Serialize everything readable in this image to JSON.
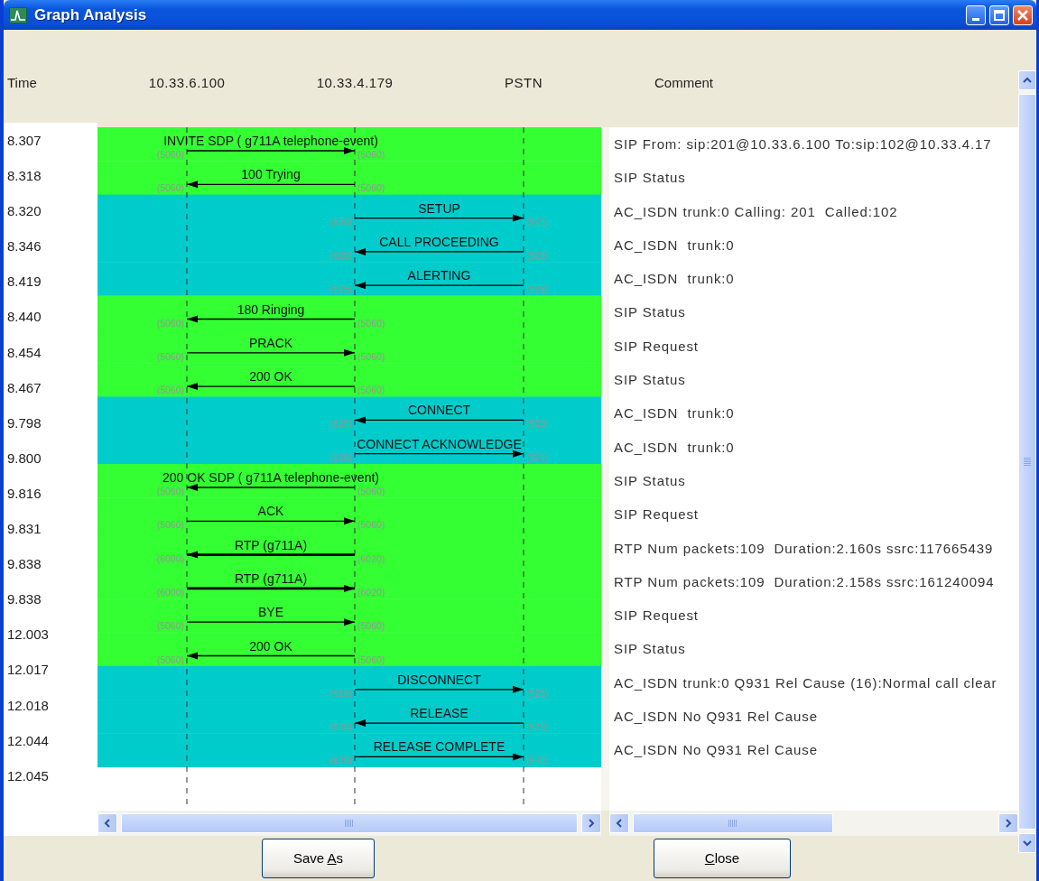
{
  "window": {
    "title": "Graph Analysis"
  },
  "header": {
    "time": "Time",
    "nodes": [
      "10.33.6.100",
      "10.33.4.179",
      "PSTN"
    ],
    "comment": "Comment"
  },
  "messages": [
    {
      "time": "8.307",
      "kind": "sip",
      "to_right": true,
      "label": "INVITE SDP ( g711A telephone-event)",
      "port_left": "(5060)",
      "port_right": "(5060)",
      "comment": "SIP From: sip:201@10.33.6.100 To:sip:102@10.33.4.17",
      "color": "#33ff33"
    },
    {
      "time": "8.318",
      "kind": "sip",
      "to_right": false,
      "label": "100 Trying",
      "port_left": "(5060)",
      "port_right": "(5060)",
      "comment": "SIP Status",
      "color": "#33ff33"
    },
    {
      "time": "8.320",
      "kind": "isdn",
      "to_right": true,
      "label": "SETUP",
      "port_left": "(928)",
      "port_right": "(925)",
      "comment": "AC_ISDN trunk:0 Calling: 201  Called:102",
      "color": "#00cccc"
    },
    {
      "time": "8.346",
      "kind": "isdn",
      "to_right": false,
      "label": "CALL PROCEEDING",
      "port_left": "(928)",
      "port_right": "(928)",
      "comment": "AC_ISDN  trunk:0",
      "color": "#00cccc"
    },
    {
      "time": "8.419",
      "kind": "isdn",
      "to_right": false,
      "label": "ALERTING",
      "port_left": "(925)",
      "port_right": "(928)",
      "comment": "AC_ISDN  trunk:0",
      "color": "#00cccc"
    },
    {
      "time": "8.440",
      "kind": "sip",
      "to_right": false,
      "label": "180 Ringing",
      "port_left": "(5060)",
      "port_right": "(5060)",
      "comment": "SIP Status",
      "color": "#33ff33"
    },
    {
      "time": "8.454",
      "kind": "sip",
      "to_right": true,
      "label": "PRACK",
      "port_left": "(5060)",
      "port_right": "(5060)",
      "comment": "SIP Request",
      "color": "#33ff33"
    },
    {
      "time": "8.467",
      "kind": "sip",
      "to_right": false,
      "label": "200 OK",
      "port_left": "(5060)",
      "port_right": "(5060)",
      "comment": "SIP Status",
      "color": "#33ff33"
    },
    {
      "time": "9.798",
      "kind": "isdn",
      "to_right": false,
      "label": "CONNECT",
      "port_left": "(925)",
      "port_right": "(928)",
      "comment": "AC_ISDN  trunk:0",
      "color": "#00cccc"
    },
    {
      "time": "9.800",
      "kind": "isdn",
      "to_right": true,
      "label": "CONNECT ACKNOWLEDGE",
      "port_left": "(928)",
      "port_right": "(925)",
      "comment": "AC_ISDN  trunk:0",
      "color": "#00cccc"
    },
    {
      "time": "9.816",
      "kind": "sip",
      "to_right": false,
      "label": "200 OK SDP ( g711A telephone-event)",
      "port_left": "(5060)",
      "port_right": "(5060)",
      "comment": "SIP Status",
      "color": "#33ff33"
    },
    {
      "time": "9.831",
      "kind": "sip",
      "to_right": true,
      "label": "ACK",
      "port_left": "(5060)",
      "port_right": "(5060)",
      "comment": "SIP Request",
      "color": "#33ff33"
    },
    {
      "time": "9.838",
      "kind": "rtp",
      "to_right": false,
      "label": "RTP (g711A)",
      "port_left": "(6000)",
      "port_right": "(6020)",
      "comment": "RTP Num packets:109  Duration:2.160s ssrc:117665439",
      "color": "#33ff33"
    },
    {
      "time": "9.838",
      "kind": "rtp",
      "to_right": true,
      "label": "RTP (g711A)",
      "port_left": "(6000)",
      "port_right": "(6020)",
      "comment": "RTP Num packets:109  Duration:2.158s ssrc:161240094",
      "color": "#33ff33"
    },
    {
      "time": "12.003",
      "kind": "sip",
      "to_right": true,
      "label": "BYE",
      "port_left": "(5060)",
      "port_right": "(5060)",
      "comment": "SIP Request",
      "color": "#33ff33"
    },
    {
      "time": "12.017",
      "kind": "sip",
      "to_right": false,
      "label": "200 OK",
      "port_left": "(5060)",
      "port_right": "(5060)",
      "comment": "SIP Status",
      "color": "#33ff33"
    },
    {
      "time": "12.018",
      "kind": "isdn",
      "to_right": true,
      "label": "DISCONNECT",
      "port_left": "(928)",
      "port_right": "(925)",
      "comment": "AC_ISDN trunk:0 Q931 Rel Cause (16):Normal call clear",
      "color": "#00cccc"
    },
    {
      "time": "12.044",
      "kind": "isdn",
      "to_right": false,
      "label": "RELEASE",
      "port_left": "(928)",
      "port_right": "(928)",
      "comment": "AC_ISDN No Q931 Rel Cause",
      "color": "#00cccc"
    },
    {
      "time": "12.045",
      "kind": "isdn",
      "to_right": true,
      "label": "RELEASE COMPLETE",
      "port_left": "(928)",
      "port_right": "(925)",
      "comment": "AC_ISDN No Q931 Rel Cause",
      "color": "#00cccc"
    }
  ],
  "buttons": [
    {
      "before": "Save ",
      "key": "A",
      "after": "s"
    },
    {
      "key": "C",
      "after": "lose"
    }
  ]
}
